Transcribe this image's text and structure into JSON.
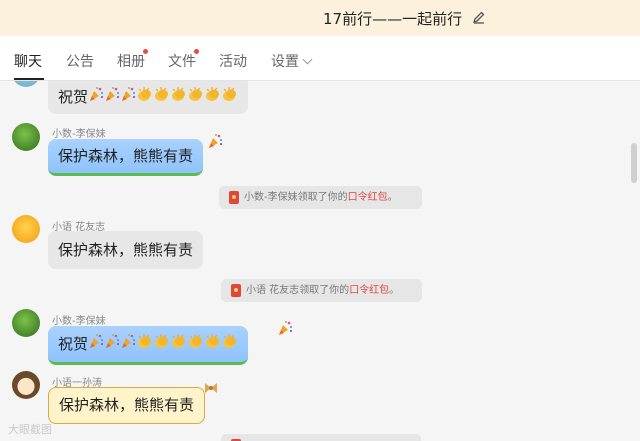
{
  "header": {
    "title": "17前行——一起前行"
  },
  "tabs": [
    {
      "label": "聊天",
      "active": true,
      "dot": false
    },
    {
      "label": "公告",
      "active": false,
      "dot": false
    },
    {
      "label": "相册",
      "active": false,
      "dot": true
    },
    {
      "label": "文件",
      "active": false,
      "dot": true
    },
    {
      "label": "活动",
      "active": false,
      "dot": false
    },
    {
      "label": "设置",
      "active": false,
      "dot": false
    }
  ],
  "messages": [
    {
      "sender": "",
      "text": "祝贺",
      "style": "plain",
      "emoji": "3 party-poppers, 6 clapping-hands"
    },
    {
      "sender": "小数-李保妹",
      "text": "保护森林，熊熊有责",
      "style": "blue"
    },
    {
      "system": true,
      "sender": "小数-李保妹",
      "text": "领取了你的",
      "link": "口令红包",
      "end": "。"
    },
    {
      "sender": "小语 花友志",
      "text": "保护森林，熊熊有责",
      "style": "plain"
    },
    {
      "system": true,
      "sender": "小语 花友志",
      "text": "领取了你的",
      "link": "口令红包",
      "end": "。"
    },
    {
      "sender": "小数-李保妹",
      "text": "祝贺",
      "style": "blue",
      "emoji": "3 party-poppers, 6 clapping-hands"
    },
    {
      "sender": "小语一孙涛",
      "text": "保护森林，熊熊有责",
      "style": "yellow"
    }
  ],
  "watermark": "大眼截图",
  "colors": {
    "titlebar": "#fcf1dc",
    "accent_red": "#e0463e",
    "chat_bg": "#f5f5f5"
  }
}
